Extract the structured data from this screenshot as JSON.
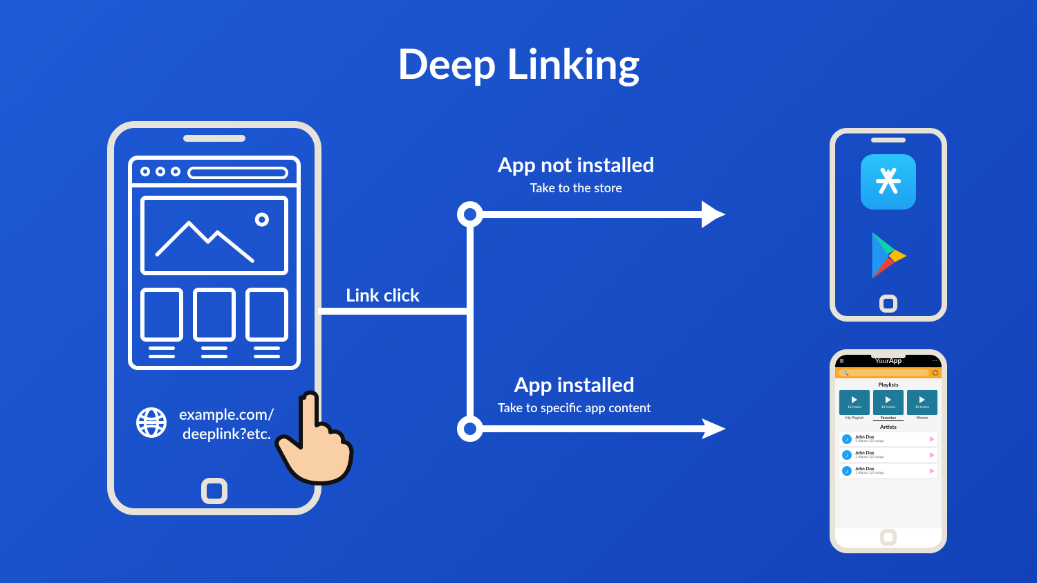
{
  "title": "Deep Linking",
  "source_phone": {
    "url_line1": "example.com/",
    "url_line2": "deeplink?etc."
  },
  "flow": {
    "link_click_label": "Link click",
    "branches": {
      "not_installed": {
        "heading": "App not installed",
        "sub": "Take to the store"
      },
      "installed": {
        "heading": "App installed",
        "sub": "Take to specific app content"
      }
    }
  },
  "store_phone": {
    "app_store": "App Store",
    "play_store": "Google Play"
  },
  "your_app": {
    "brand_prefix": "Your",
    "brand_bold": "App",
    "section_playlists": "Playlists",
    "section_artists": "Artists",
    "tile_count": "12 tracks",
    "tabs": [
      "My Playlist",
      "Favorites",
      "Winter"
    ],
    "artist_rows": [
      {
        "name": "John Doe",
        "detail": "1 Album | 23 songs"
      },
      {
        "name": "John Doe",
        "detail": "1 Album | 23 songs"
      },
      {
        "name": "John Doe",
        "detail": "1 Album | 23 songs"
      }
    ]
  }
}
